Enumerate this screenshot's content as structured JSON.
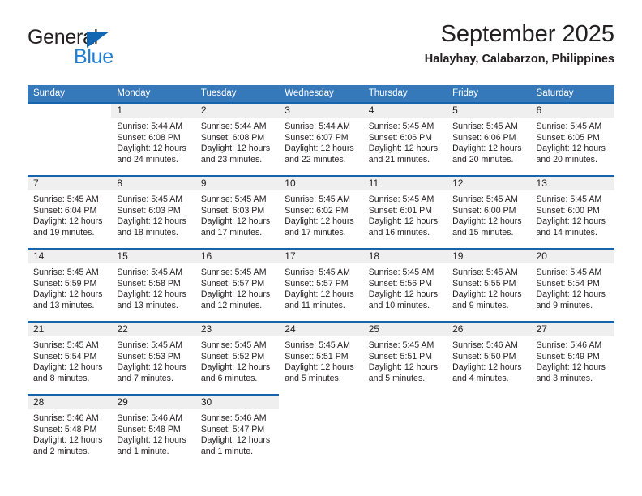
{
  "brand": {
    "name_part1": "General",
    "name_part2": "Blue",
    "triangle_color": "#1167b1",
    "blue_color": "#1f7fd4"
  },
  "header": {
    "title": "September 2025",
    "subtitle": "Halayhay, Calabarzon, Philippines"
  },
  "theme": {
    "header_bg": "#3579ba",
    "separator": "#1664ab",
    "day_band_bg": "#efefef",
    "text": "#231f20"
  },
  "weekdays": [
    "Sunday",
    "Monday",
    "Tuesday",
    "Wednesday",
    "Thursday",
    "Friday",
    "Saturday"
  ],
  "weeks": [
    [
      {
        "day": "",
        "empty": true
      },
      {
        "day": "1",
        "sunrise": "Sunrise: 5:44 AM",
        "sunset": "Sunset: 6:08 PM",
        "daylight": "Daylight: 12 hours and 24 minutes."
      },
      {
        "day": "2",
        "sunrise": "Sunrise: 5:44 AM",
        "sunset": "Sunset: 6:08 PM",
        "daylight": "Daylight: 12 hours and 23 minutes."
      },
      {
        "day": "3",
        "sunrise": "Sunrise: 5:44 AM",
        "sunset": "Sunset: 6:07 PM",
        "daylight": "Daylight: 12 hours and 22 minutes."
      },
      {
        "day": "4",
        "sunrise": "Sunrise: 5:45 AM",
        "sunset": "Sunset: 6:06 PM",
        "daylight": "Daylight: 12 hours and 21 minutes."
      },
      {
        "day": "5",
        "sunrise": "Sunrise: 5:45 AM",
        "sunset": "Sunset: 6:06 PM",
        "daylight": "Daylight: 12 hours and 20 minutes."
      },
      {
        "day": "6",
        "sunrise": "Sunrise: 5:45 AM",
        "sunset": "Sunset: 6:05 PM",
        "daylight": "Daylight: 12 hours and 20 minutes."
      }
    ],
    [
      {
        "day": "7",
        "sunrise": "Sunrise: 5:45 AM",
        "sunset": "Sunset: 6:04 PM",
        "daylight": "Daylight: 12 hours and 19 minutes."
      },
      {
        "day": "8",
        "sunrise": "Sunrise: 5:45 AM",
        "sunset": "Sunset: 6:03 PM",
        "daylight": "Daylight: 12 hours and 18 minutes."
      },
      {
        "day": "9",
        "sunrise": "Sunrise: 5:45 AM",
        "sunset": "Sunset: 6:03 PM",
        "daylight": "Daylight: 12 hours and 17 minutes."
      },
      {
        "day": "10",
        "sunrise": "Sunrise: 5:45 AM",
        "sunset": "Sunset: 6:02 PM",
        "daylight": "Daylight: 12 hours and 17 minutes."
      },
      {
        "day": "11",
        "sunrise": "Sunrise: 5:45 AM",
        "sunset": "Sunset: 6:01 PM",
        "daylight": "Daylight: 12 hours and 16 minutes."
      },
      {
        "day": "12",
        "sunrise": "Sunrise: 5:45 AM",
        "sunset": "Sunset: 6:00 PM",
        "daylight": "Daylight: 12 hours and 15 minutes."
      },
      {
        "day": "13",
        "sunrise": "Sunrise: 5:45 AM",
        "sunset": "Sunset: 6:00 PM",
        "daylight": "Daylight: 12 hours and 14 minutes."
      }
    ],
    [
      {
        "day": "14",
        "sunrise": "Sunrise: 5:45 AM",
        "sunset": "Sunset: 5:59 PM",
        "daylight": "Daylight: 12 hours and 13 minutes."
      },
      {
        "day": "15",
        "sunrise": "Sunrise: 5:45 AM",
        "sunset": "Sunset: 5:58 PM",
        "daylight": "Daylight: 12 hours and 13 minutes."
      },
      {
        "day": "16",
        "sunrise": "Sunrise: 5:45 AM",
        "sunset": "Sunset: 5:57 PM",
        "daylight": "Daylight: 12 hours and 12 minutes."
      },
      {
        "day": "17",
        "sunrise": "Sunrise: 5:45 AM",
        "sunset": "Sunset: 5:57 PM",
        "daylight": "Daylight: 12 hours and 11 minutes."
      },
      {
        "day": "18",
        "sunrise": "Sunrise: 5:45 AM",
        "sunset": "Sunset: 5:56 PM",
        "daylight": "Daylight: 12 hours and 10 minutes."
      },
      {
        "day": "19",
        "sunrise": "Sunrise: 5:45 AM",
        "sunset": "Sunset: 5:55 PM",
        "daylight": "Daylight: 12 hours and 9 minutes."
      },
      {
        "day": "20",
        "sunrise": "Sunrise: 5:45 AM",
        "sunset": "Sunset: 5:54 PM",
        "daylight": "Daylight: 12 hours and 9 minutes."
      }
    ],
    [
      {
        "day": "21",
        "sunrise": "Sunrise: 5:45 AM",
        "sunset": "Sunset: 5:54 PM",
        "daylight": "Daylight: 12 hours and 8 minutes."
      },
      {
        "day": "22",
        "sunrise": "Sunrise: 5:45 AM",
        "sunset": "Sunset: 5:53 PM",
        "daylight": "Daylight: 12 hours and 7 minutes."
      },
      {
        "day": "23",
        "sunrise": "Sunrise: 5:45 AM",
        "sunset": "Sunset: 5:52 PM",
        "daylight": "Daylight: 12 hours and 6 minutes."
      },
      {
        "day": "24",
        "sunrise": "Sunrise: 5:45 AM",
        "sunset": "Sunset: 5:51 PM",
        "daylight": "Daylight: 12 hours and 5 minutes."
      },
      {
        "day": "25",
        "sunrise": "Sunrise: 5:45 AM",
        "sunset": "Sunset: 5:51 PM",
        "daylight": "Daylight: 12 hours and 5 minutes."
      },
      {
        "day": "26",
        "sunrise": "Sunrise: 5:46 AM",
        "sunset": "Sunset: 5:50 PM",
        "daylight": "Daylight: 12 hours and 4 minutes."
      },
      {
        "day": "27",
        "sunrise": "Sunrise: 5:46 AM",
        "sunset": "Sunset: 5:49 PM",
        "daylight": "Daylight: 12 hours and 3 minutes."
      }
    ],
    [
      {
        "day": "28",
        "sunrise": "Sunrise: 5:46 AM",
        "sunset": "Sunset: 5:48 PM",
        "daylight": "Daylight: 12 hours and 2 minutes."
      },
      {
        "day": "29",
        "sunrise": "Sunrise: 5:46 AM",
        "sunset": "Sunset: 5:48 PM",
        "daylight": "Daylight: 12 hours and 1 minute."
      },
      {
        "day": "30",
        "sunrise": "Sunrise: 5:46 AM",
        "sunset": "Sunset: 5:47 PM",
        "daylight": "Daylight: 12 hours and 1 minute."
      },
      {
        "day": "",
        "empty": true
      },
      {
        "day": "",
        "empty": true
      },
      {
        "day": "",
        "empty": true
      },
      {
        "day": "",
        "empty": true
      }
    ]
  ]
}
